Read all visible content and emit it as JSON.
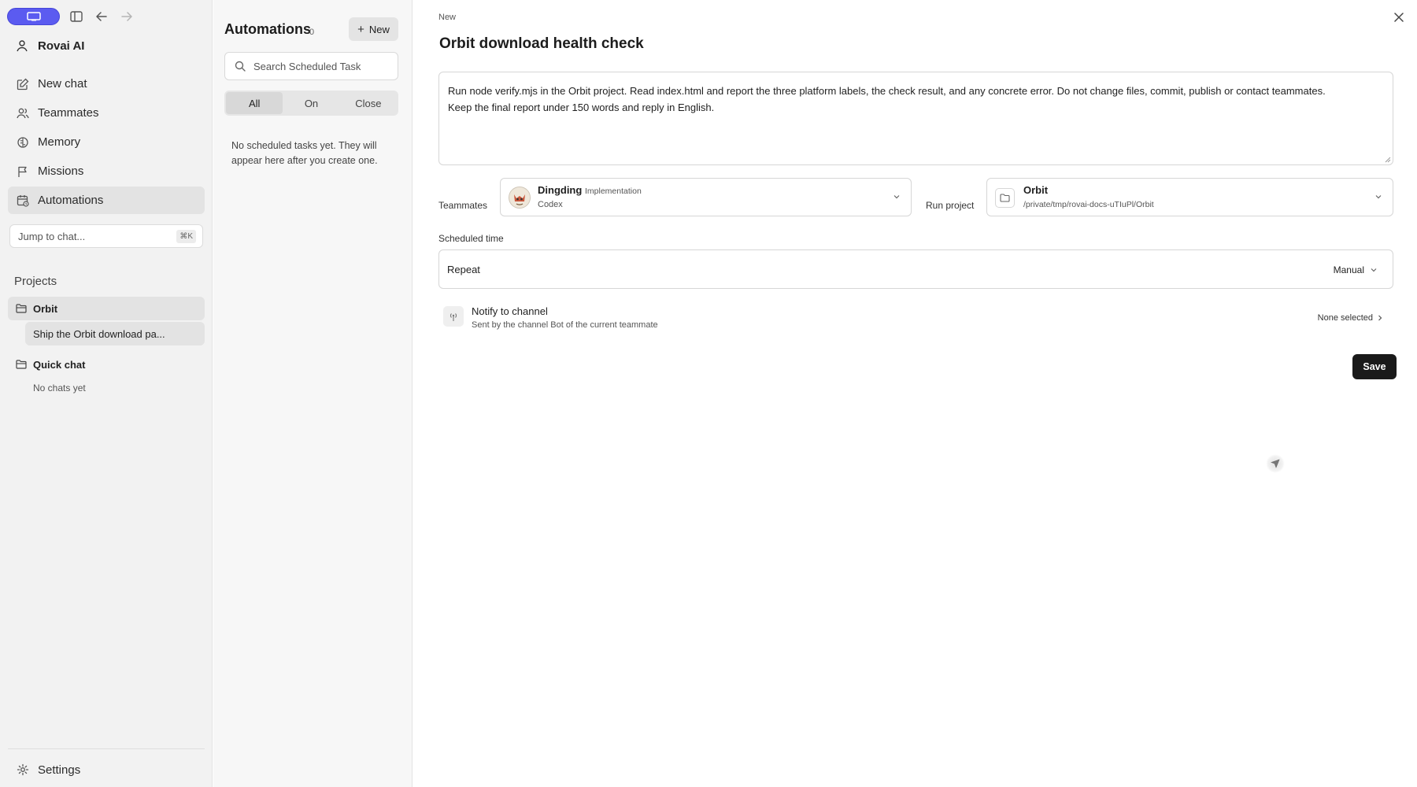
{
  "sidebar": {
    "brand": "Rovai AI",
    "nav": [
      {
        "label": "New chat",
        "icon": "edit-icon"
      },
      {
        "label": "Teammates",
        "icon": "users-icon"
      },
      {
        "label": "Memory",
        "icon": "brain-icon"
      },
      {
        "label": "Missions",
        "icon": "flag-icon"
      },
      {
        "label": "Automations",
        "icon": "calendar-clock-icon",
        "active": true
      }
    ],
    "jump": {
      "placeholder": "Jump to chat...",
      "shortcut": "⌘K"
    },
    "projects_title": "Projects",
    "projects": [
      {
        "name": "Orbit",
        "chats": [
          "Ship the Orbit download pa..."
        ]
      },
      {
        "name": "Quick chat",
        "empty": "No chats yet"
      }
    ],
    "settings": "Settings"
  },
  "automations": {
    "title": "Automations",
    "count": "0",
    "new_label": "New",
    "search_placeholder": "Search Scheduled Task",
    "filters": [
      "All",
      "On",
      "Close"
    ],
    "active_filter": "All",
    "empty": "No scheduled tasks yet. They will appear here after you create one."
  },
  "editor": {
    "crumb": "New",
    "title": "Orbit download health check",
    "prompt_line1": "Run node verify.mjs in the Orbit project. Read index.html and report the three platform labels, the check result, and any concrete error. Do not change files, commit, publish or contact teammates.",
    "prompt_line2": "Keep the final report under 150 words and reply in English.",
    "teammates_label": "Teammates",
    "teammate": {
      "name": "Dingding",
      "role": "Implementation",
      "engine": "Codex"
    },
    "run_project_label": "Run project",
    "project": {
      "name": "Orbit",
      "path": "/private/tmp/rovai-docs-uTIuPl/Orbit"
    },
    "scheduled_label": "Scheduled time",
    "repeat_label": "Repeat",
    "repeat_value": "Manual",
    "notify": {
      "title": "Notify to channel",
      "subtitle": "Sent by the channel Bot of the current teammate",
      "value": "None selected"
    },
    "save_label": "Save"
  },
  "colors": {
    "accent": "#5b5bf0",
    "save_bg": "#1a1a1a"
  }
}
